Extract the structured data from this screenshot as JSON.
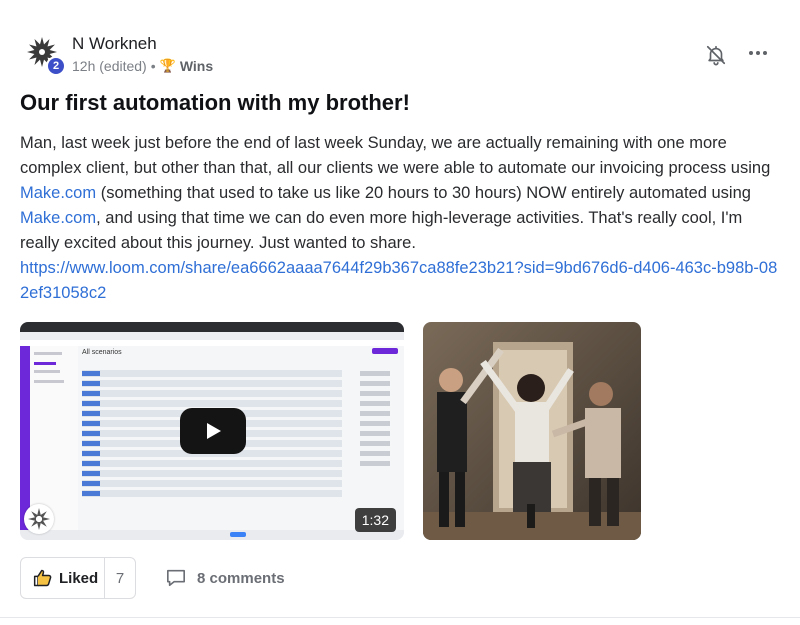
{
  "post": {
    "author": "N Workneh",
    "level": "2",
    "timestamp": "12h (edited)",
    "separator": "•",
    "category_icon": "trophy-icon",
    "category": "Wins",
    "title": "Our first automation with my brother!",
    "body": {
      "p1": "Man, last week just before the end of last week Sunday, we are actually remaining with one more complex client, but other than that, all our clients we were able to automate our invoicing process using ",
      "link1": "Make.com",
      "p2": " (something that used to take us like 20 hours to 30 hours) NOW entirely automated using ",
      "link2": "Make.com",
      "p3": ", and using that time we can do even more high-leverage activities. That's really cool, I'm really excited about this journey. Just wanted to share.",
      "url": "https://www.loom.com/share/ea6662aaaa7644f29b367ca88fe23b21?sid=9bd676d6-d406-463c-b98b-082ef31058c2"
    },
    "video": {
      "duration": "1:32",
      "screen_heading": "All scenarios"
    },
    "actions": {
      "like_label": "Liked",
      "like_count": "7",
      "comments_label": "8 comments"
    },
    "colors": {
      "accent_link": "#2f6fd6",
      "badge": "#3d4fc8",
      "make_purple": "#6d28d9"
    }
  }
}
